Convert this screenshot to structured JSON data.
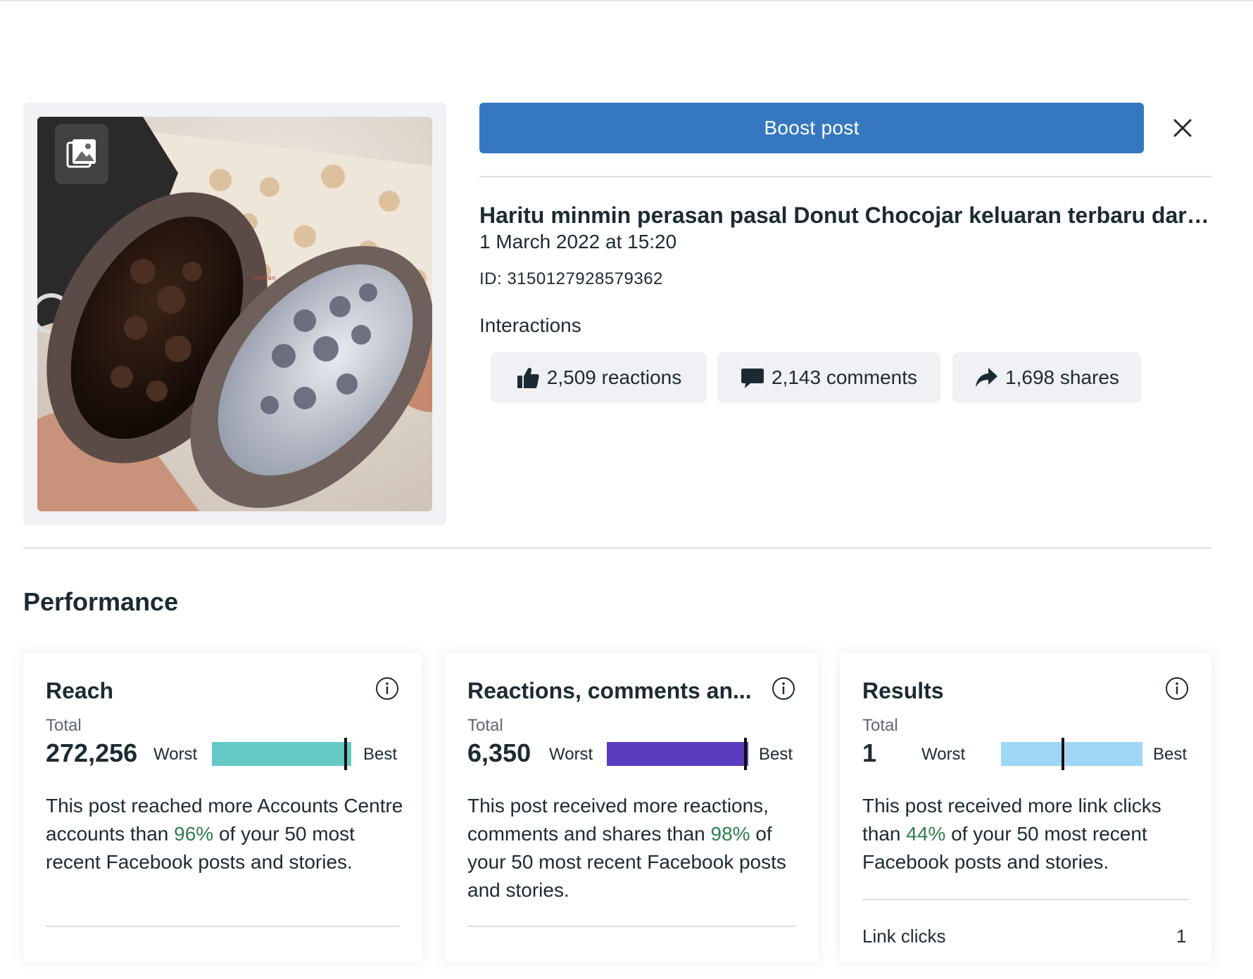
{
  "header": {
    "boost_label": "Boost post"
  },
  "post": {
    "title": "Haritu minmin perasan pasal Donut Chocojar keluaran terbaru dari ...",
    "date": "1 March 2022 at 15:20",
    "id": "ID: 3150127928579362",
    "image_text": "matian"
  },
  "interactions": {
    "label": "Interactions",
    "reactions": "2,509 reactions",
    "comments": "2,143 comments",
    "shares": "1,698 shares"
  },
  "performance": {
    "title": "Performance",
    "cards": [
      {
        "title": "Reach",
        "total_label": "Total",
        "value": "272,256",
        "worst": "Worst",
        "best": "Best",
        "bar_color": "#62c9c5",
        "bar_level": 0.96,
        "desc_before": "This post reached more Accounts Centre accounts than ",
        "percent": "96%",
        "desc_after": " of your 50 most recent Facebook posts and stories."
      },
      {
        "title": "Reactions, comments an...",
        "total_label": "Total",
        "value": "6,350",
        "worst": "Worst",
        "best": "Best",
        "bar_color": "#5a3cc0",
        "bar_level": 0.98,
        "desc_before": "This post received more reactions, comments and shares than ",
        "percent": "98%",
        "desc_after": " of your 50 most recent Facebook posts and stories."
      },
      {
        "title": "Results",
        "total_label": "Total",
        "value": "1",
        "worst": "Worst",
        "best": "Best",
        "bar_color": "#9fd6f8",
        "bar_level": 0.44,
        "desc_before": "This post received more link clicks than ",
        "percent": "44%",
        "desc_after": " of your 50 most recent Facebook posts and stories.",
        "row_label": "Link clicks",
        "row_value": "1"
      }
    ]
  },
  "colors": {
    "accent": "#3578bf",
    "positive": "#2e7d4f"
  },
  "icons": {
    "photo_badge": "photo-album-icon",
    "close": "close-icon",
    "reactions": "thumbs-up-icon",
    "comments": "comment-bubble-icon",
    "shares": "share-arrow-icon",
    "info": "info-icon"
  }
}
